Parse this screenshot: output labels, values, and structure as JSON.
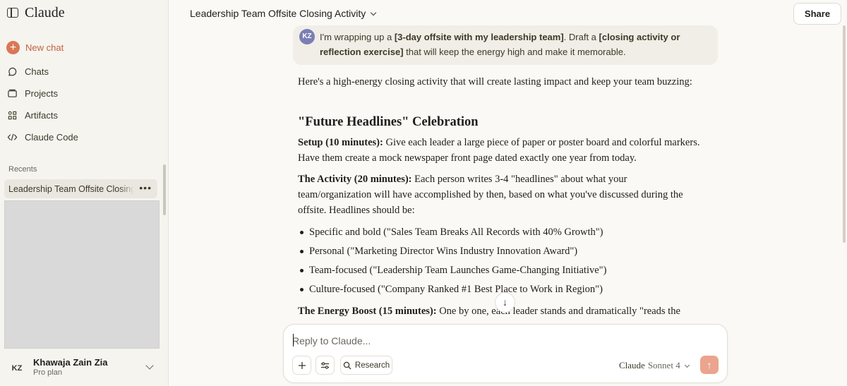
{
  "sidebar": {
    "logo": "Claude",
    "new_chat": "New chat",
    "nav": [
      {
        "label": "Chats",
        "icon": "chat-bubble-icon"
      },
      {
        "label": "Projects",
        "icon": "folder-icon"
      },
      {
        "label": "Artifacts",
        "icon": "grid-icon"
      },
      {
        "label": "Claude Code",
        "icon": "code-icon"
      }
    ],
    "recents_label": "Recents",
    "recent_item": "Leadership Team Offsite Closing Activity",
    "user": {
      "initials": "KZ",
      "name": "Khawaja Zain Zia",
      "plan": "Pro plan"
    }
  },
  "header": {
    "title": "Leadership Team Offsite Closing Activity",
    "share": "Share"
  },
  "user_message": {
    "initials": "KZ",
    "pre": "I'm wrapping up a ",
    "b1": "[3-day offsite with my leadership team]",
    "mid": ". Draft a ",
    "b2": "[closing activity or reflection exercise]",
    "post": " that will keep the energy high and make it memorable."
  },
  "response": {
    "intro": "Here's a high-energy closing activity that will create lasting impact and keep your team buzzing:",
    "heading": "\"Future Headlines\" Celebration",
    "setup_label": "Setup (10 minutes):",
    "setup_text": " Give each leader a large piece of paper or poster board and colorful markers. Have them create a mock newspaper front page dated exactly one year from today.",
    "activity_label": "The Activity (20 minutes):",
    "activity_text": " Each person writes 3-4 \"headlines\" about what your team/organization will have accomplished by then, based on what you've discussed during the offsite. Headlines should be:",
    "bullets": [
      "Specific and bold (\"Sales Team Breaks All Records with 40% Growth\")",
      "Personal (\"Marketing Director Wins Industry Innovation Award\")",
      "Team-focused (\"Leadership Team Launches Game-Changing Initiative\")",
      "Culture-focused (\"Company Ranked #1 Best Place to Work in Region\")"
    ],
    "boost_label": "The Energy Boost (15 minutes):",
    "boost_text": " One by one, each leader stands and dramatically \"reads the"
  },
  "composer": {
    "placeholder": "Reply to Claude...",
    "research": "Research",
    "model_name": "Claude",
    "model_version": "Sonnet 4"
  },
  "colors": {
    "accent": "#d97757",
    "send": "#eba48d",
    "background": "#faf9f5",
    "sidebar": "#f5f4ef"
  }
}
